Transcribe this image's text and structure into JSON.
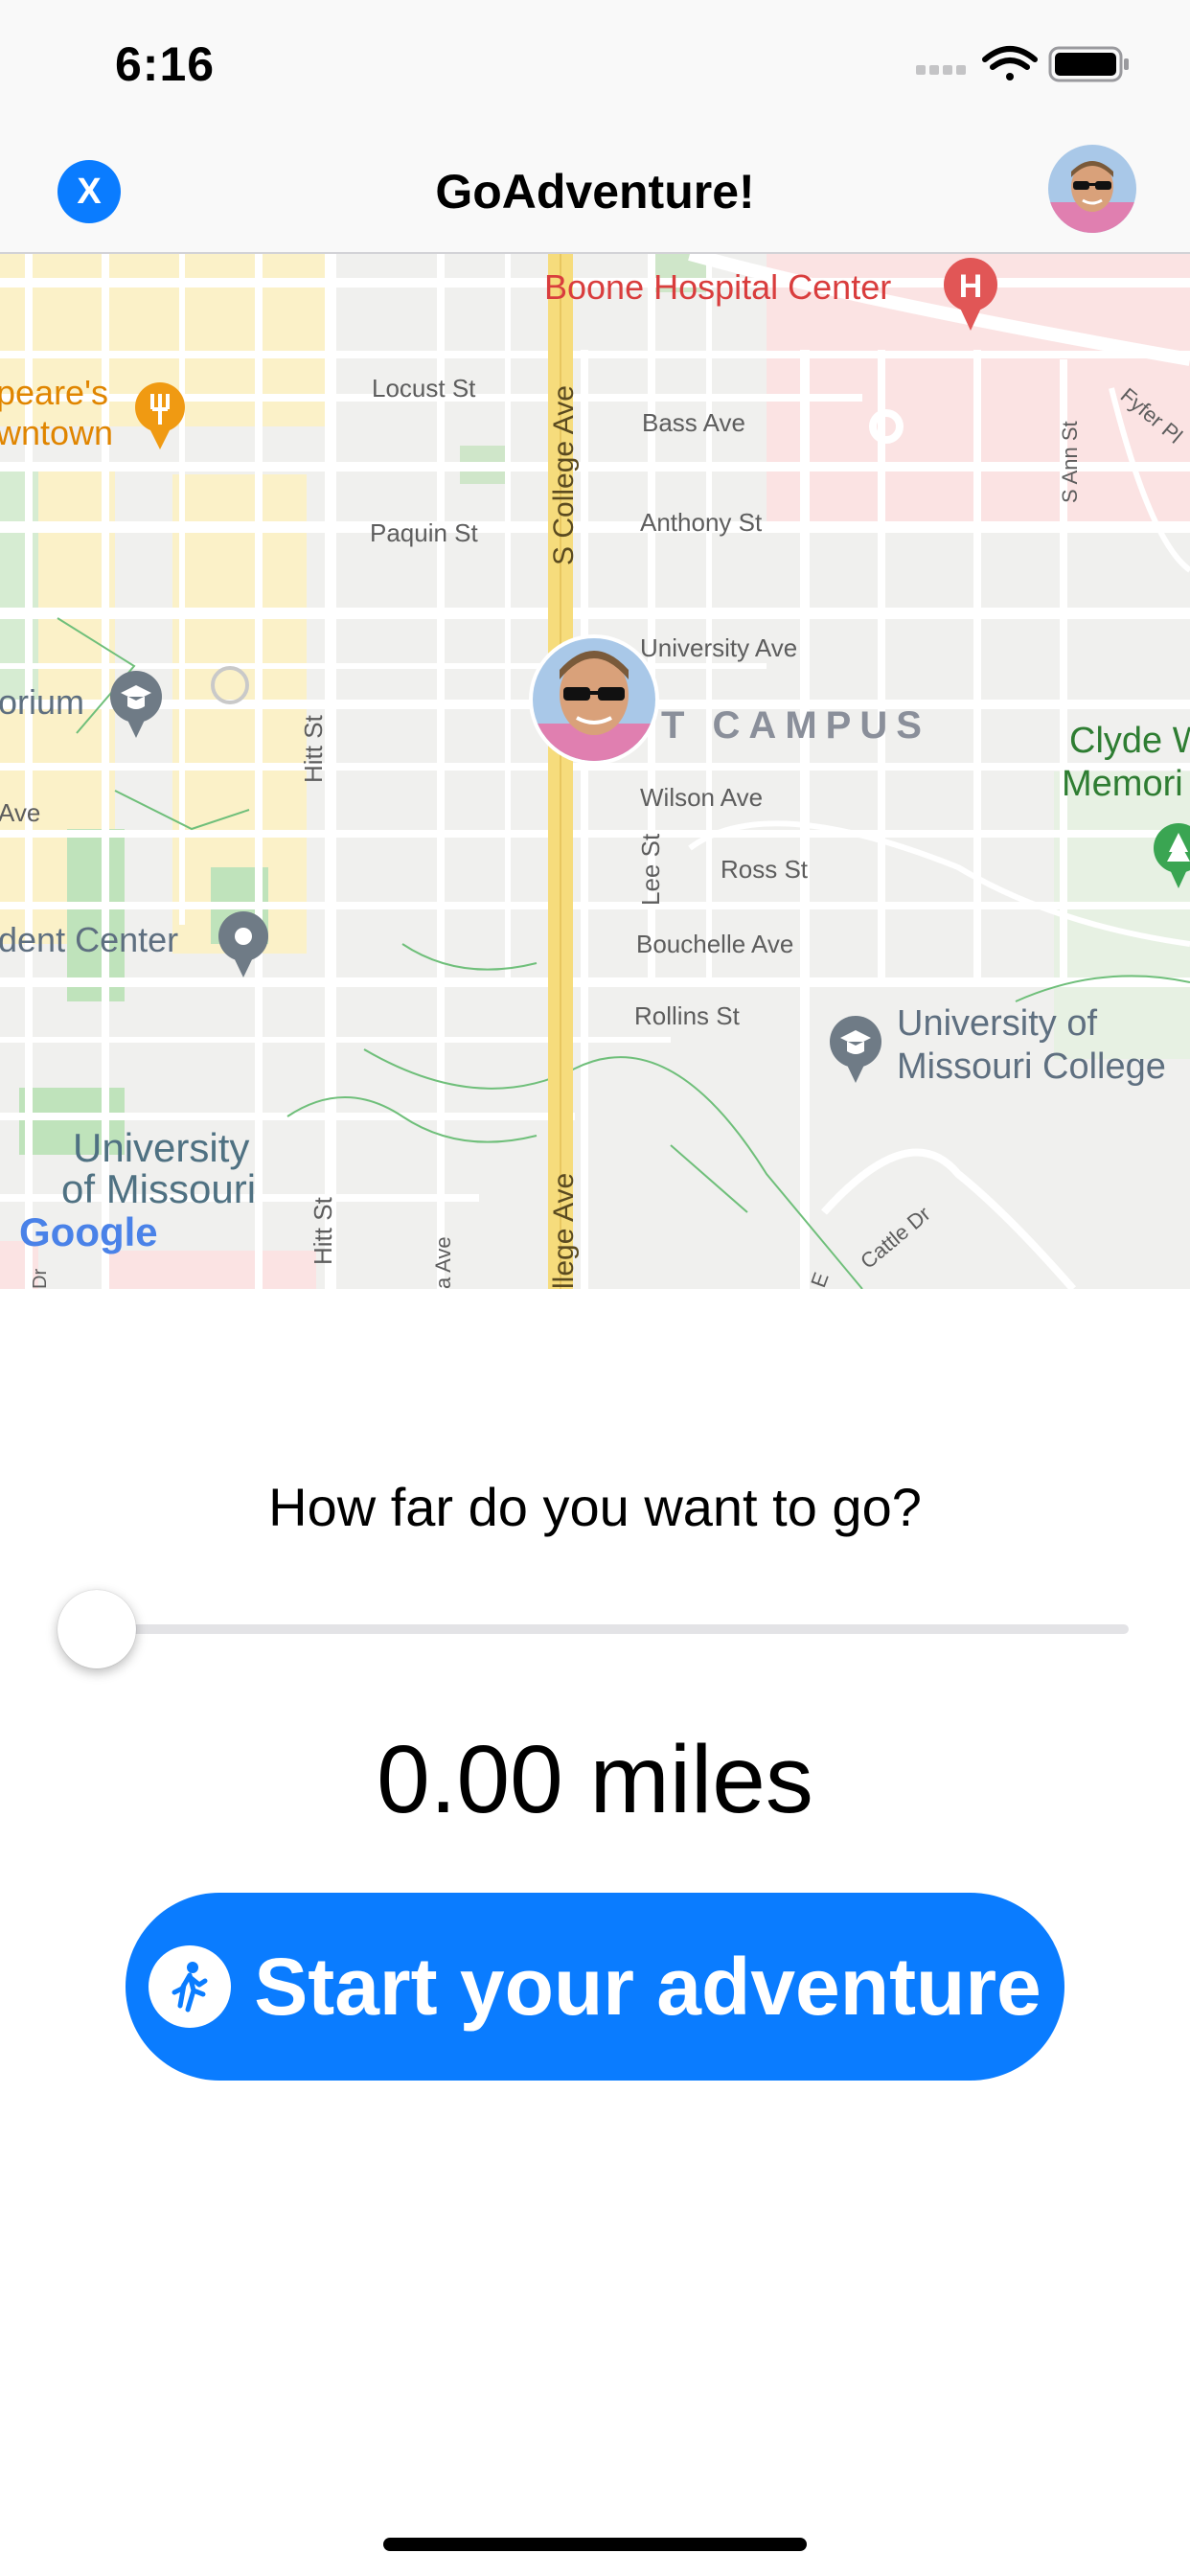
{
  "status_bar": {
    "time": "6:16",
    "icons": [
      "signal-icon",
      "wifi-icon",
      "battery-icon"
    ]
  },
  "nav": {
    "close_label": "X",
    "title": "GoAdventure!",
    "avatar": "avatar"
  },
  "map": {
    "hospital": "Boone Hospital Center",
    "restaurant_line1": "peare's",
    "restaurant_line2": "wntown",
    "locust": "Locust St",
    "bass": "Bass Ave",
    "anthony": "Anthony St",
    "paquin": "Paquin St",
    "college_north": "S College Ave",
    "college_south": "llege Ave",
    "university_ave": "University Ave",
    "campus": "T CAMPUS",
    "orium": "orium",
    "ave_left": "Ave",
    "wilson": "Wilson Ave",
    "ross": "Ross St",
    "lee": "Lee St",
    "hitt_north": "Hitt St",
    "hitt_south": "Hitt St",
    "bouchelle": "Bouchelle Ave",
    "student_center": "dent Center",
    "rollins": "Rollins St",
    "univ_college_1": "University of",
    "univ_college_2": "Missouri College",
    "clyde_1": "Clyde W",
    "clyde_2": "Memori",
    "univ_missouri_1": "University",
    "univ_missouri_2": "of Missouri",
    "s_ann": "S Ann St",
    "fyfer": "Fyfer Pl",
    "cattle": "Cattle Dr",
    "e_label": "E",
    "ave_south": "a Ave",
    "dr_left": "Dr",
    "google": "Google",
    "colors": {
      "hospital_red": "#d93d3d",
      "restaurant_orange": "#ef8c00",
      "park_green": "#2e7d32",
      "college_road": "#f6dc7c"
    }
  },
  "controls": {
    "prompt": "How far do you want to go?",
    "slider_value": 0,
    "distance_text": "0.00 miles",
    "start_label": "Start your adventure",
    "start_icon": "walking-person-icon",
    "accent": "#0a7cff"
  }
}
